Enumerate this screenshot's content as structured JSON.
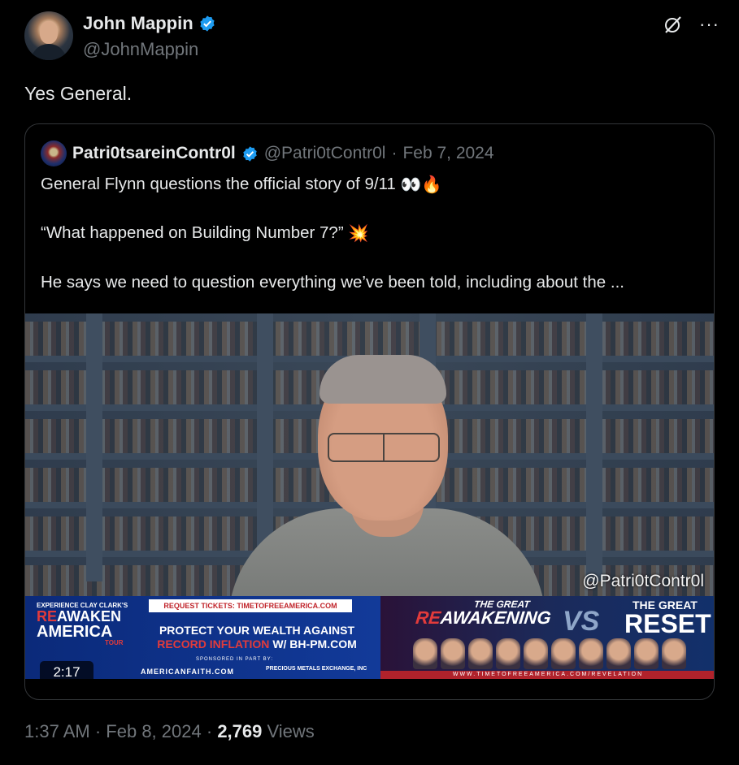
{
  "author": {
    "name": "John Mappin",
    "handle": "@JohnMappin"
  },
  "tweet": {
    "text": "Yes General."
  },
  "quote": {
    "name": "Patri0tsareinContr0l",
    "handle": "@Patri0tContr0l",
    "date": "Feb 7, 2024",
    "line1": "General Flynn questions the official story of 9/11",
    "line1_emoji": "👀🔥",
    "line2": "“What happened on Building Number 7?”",
    "line2_emoji": "💥",
    "line3": "He says we need to question everything we’ve been told, including about the ...",
    "video": {
      "watermark": "@Patri0tContr0l",
      "duration": "2:17",
      "banner": {
        "experience": "EXPERIENCE CLAY CLARK'S",
        "reawaken_re": "RE",
        "reawaken": "AWAKEN",
        "america": "AMERICA",
        "tour": "TOUR",
        "tickets": "REQUEST TICKETS: TIMETOFREEAMERICA.COM",
        "protect": "PROTECT YOUR WEALTH AGAINST",
        "record": "RECORD INFLATION",
        "bhpm": "W/ BH-PM.COM",
        "sponsored": "SPONSORED IN PART BY:",
        "americanfaith": "AMERICANFAITH.COM",
        "pmx": "PRECIOUS METALS EXCHANGE, INC",
        "the_great_1": "THE GREAT",
        "re_1": "RE",
        "awakening": "AWAKENING",
        "vs": "VS",
        "the_great_2": "THE GREAT",
        "reset": "RESET",
        "url": "WWW.TIMETOFREEAMERICA.COM/REVELATION"
      }
    }
  },
  "footer": {
    "time": "1:37 AM",
    "sep1": "·",
    "date": "Feb 8, 2024",
    "sep2": "·",
    "views_count": "2,769",
    "views_label": "Views"
  },
  "icons": {
    "verified": "verified-badge-icon",
    "grok": "grok-icon",
    "more": "more-options-icon"
  },
  "colors": {
    "background": "#000000",
    "text": "#e7e9ea",
    "muted": "#71767b",
    "verified": "#1d9bf0",
    "border": "#333639"
  }
}
